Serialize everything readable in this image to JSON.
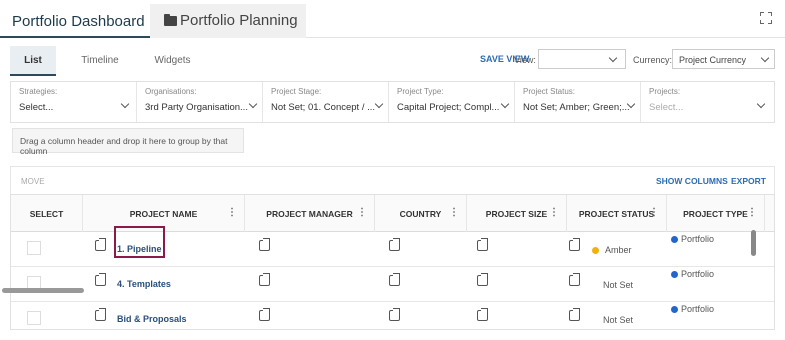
{
  "tabs": {
    "dashboard": "Portfolio Dashboard",
    "planning": "Portfolio Planning"
  },
  "subtabs": [
    "List",
    "Timeline",
    "Widgets"
  ],
  "toolbar": {
    "save_view": "SAVE VIEW",
    "view_label": "View:",
    "view_value": "",
    "currency_label": "Currency:",
    "currency_value": "Project Currency"
  },
  "filters": [
    {
      "label": "Strategies:",
      "value": "Select..."
    },
    {
      "label": "Organisations:",
      "value": "3rd Party Organisation..."
    },
    {
      "label": "Project Stage:",
      "value": "Not Set; 01. Concept / ..."
    },
    {
      "label": "Project Type:",
      "value": "Capital Project; Compl..."
    },
    {
      "label": "Project Status:",
      "value": "Not Set; Amber; Green;..."
    },
    {
      "label": "Projects:",
      "value": "Select..."
    }
  ],
  "group_hint": "Drag a column header and drop it here to group by that column",
  "actions": {
    "move": "MOVE",
    "show_columns": "SHOW COLUMNS",
    "export": "EXPORT"
  },
  "columns": [
    "SELECT",
    "PROJECT NAME",
    "PROJECT MANAGER",
    "COUNTRY",
    "PROJECT SIZE",
    "PROJECT STATUS",
    "PROJECT TYPE"
  ],
  "rows": [
    {
      "name": "1. Pipeline",
      "status": "Amber",
      "status_color": "#f0b400",
      "type": "Portfolio"
    },
    {
      "name": "4. Templates",
      "status": "Not Set",
      "status_color": "",
      "type": "Portfolio"
    },
    {
      "name": "Bid & Proposals",
      "status": "Not Set",
      "status_color": "",
      "type": "Portfolio"
    }
  ],
  "colors": {
    "accent": "#2b6db3",
    "highlight": "#8b1a4a",
    "type_dot": "#2266cc"
  }
}
